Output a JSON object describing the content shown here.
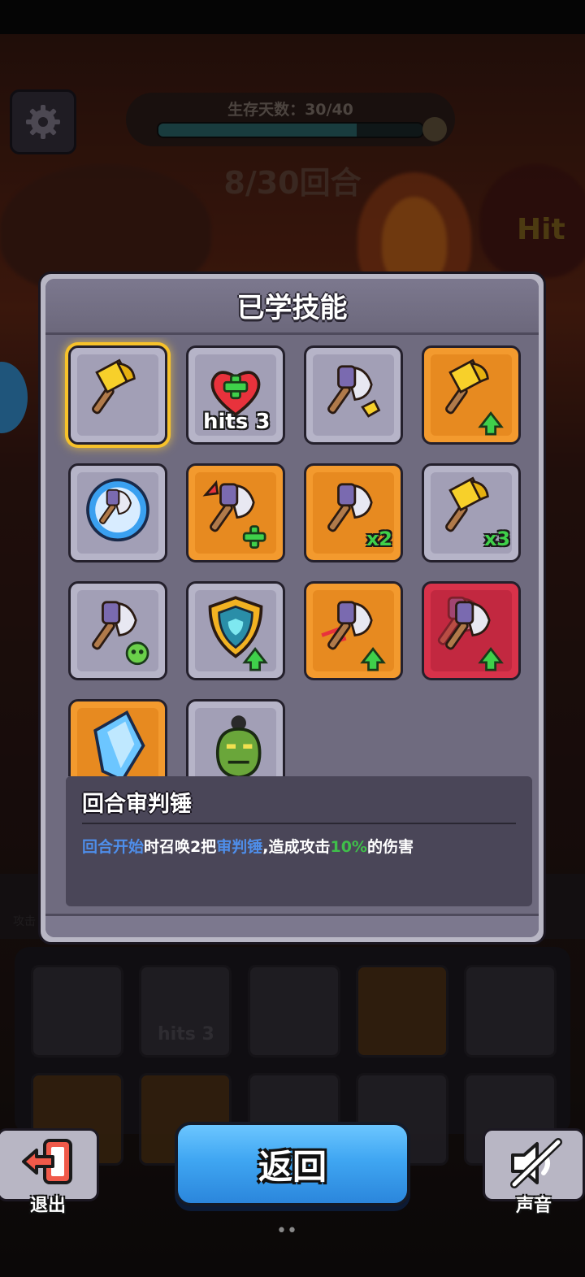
{
  "hud": {
    "survival_label": "生存天数：30/40",
    "survival_progress": 0.75,
    "round_label": "8/30回合",
    "hit_label": "Hit"
  },
  "panel": {
    "title": "已学技能",
    "skills": [
      {
        "icon": "golden-hammer-icon",
        "frame": "gray",
        "selected": true,
        "label": ""
      },
      {
        "icon": "heart-plus-icon",
        "frame": "gray",
        "selected": false,
        "label": "hits 3"
      },
      {
        "icon": "axe-with-hammer-icon",
        "frame": "gray",
        "selected": false,
        "label": ""
      },
      {
        "icon": "golden-hammer-upgrade-icon",
        "frame": "orange",
        "selected": false,
        "label": ""
      },
      {
        "icon": "axe-bubble-icon",
        "frame": "gray",
        "selected": false,
        "label": ""
      },
      {
        "icon": "axe-plus-icon",
        "frame": "orange",
        "selected": false,
        "label": ""
      },
      {
        "icon": "axe-x2-icon",
        "frame": "orange",
        "selected": false,
        "label": "x2"
      },
      {
        "icon": "golden-hammer-x3-icon",
        "frame": "gray",
        "selected": false,
        "label": "x3"
      },
      {
        "icon": "axe-poison-icon",
        "frame": "gray",
        "selected": false,
        "label": ""
      },
      {
        "icon": "shield-upgrade-icon",
        "frame": "gray",
        "selected": false,
        "label": ""
      },
      {
        "icon": "axe-crit-upgrade-icon",
        "frame": "orange",
        "selected": false,
        "label": ""
      },
      {
        "icon": "axe-speed-upgrade-icon",
        "frame": "red",
        "selected": false,
        "label": ""
      },
      {
        "icon": "ice-crystal-icon",
        "frame": "orange",
        "selected": false,
        "label": ""
      },
      {
        "icon": "orc-summon-icon",
        "frame": "gray",
        "selected": false,
        "label": ""
      }
    ],
    "description": {
      "title": "回合审判锤",
      "segments": [
        {
          "text": "回合开始",
          "color": "blue"
        },
        {
          "text": "时召唤2把",
          "color": "white"
        },
        {
          "text": "审判锤",
          "color": "blue"
        },
        {
          "text": ",造成攻击",
          "color": "white"
        },
        {
          "text": "10%",
          "color": "green"
        },
        {
          "text": "的伤害",
          "color": "white"
        }
      ]
    }
  },
  "bottom": {
    "exit_label": "退出",
    "back_label": "返回",
    "sound_label": "声音",
    "bg_tab_label": "攻击",
    "bg_hits_label": "hits 3"
  },
  "colors": {
    "accent_blue": "#3fa6f2",
    "highlight_gold": "#f7c22a",
    "desc_blue": "#4e8eea",
    "desc_green": "#3fbf4a"
  }
}
